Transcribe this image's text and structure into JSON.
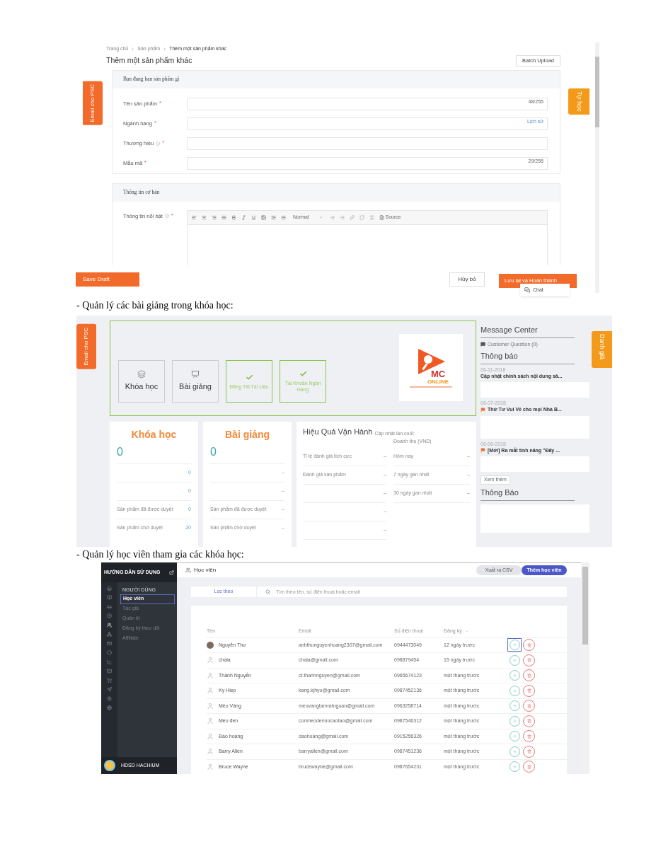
{
  "screen_1": {
    "left_tab": "Email cho PSC",
    "right_tab": "Tự học",
    "breadcrumb": [
      "Trang chủ",
      "Sản phẩm",
      "Thêm một sản phẩm khác"
    ],
    "title": "Thêm một sản phẩm khác",
    "batch_upload": "Batch Upload",
    "section_1": {
      "title": "Bạn đang bạn sản phẩm gì",
      "fields": [
        {
          "label": "Tên sản phẩm",
          "info": false,
          "mark": "*",
          "counter": "48/255"
        },
        {
          "label": "Ngành hàng",
          "info": false,
          "mark": "*",
          "link": "Lịch sử"
        },
        {
          "label": "Thương hiệu",
          "info": true,
          "mark": "*"
        },
        {
          "label": "Mẫu mã",
          "info": false,
          "mark": "*",
          "counter": "29/255"
        }
      ]
    },
    "section_2": {
      "title": "Thông tin cơ bản",
      "field": {
        "label": "Thông tin nổi bật",
        "info": true,
        "mark": "*"
      },
      "format": "Normal",
      "source": "Source"
    },
    "save_draft": "Save Draft",
    "cancel": "Hủy bỏ",
    "finish": "Lưu lại và Hoàn thành",
    "chat": "Chat"
  },
  "caption_1": "- Quản lý các bài giảng trong khóa học:",
  "screen_2": {
    "left_tab": "Email cho PSC",
    "right_tab": "Danh giá",
    "tiles": [
      {
        "label": "Khóa học",
        "kind": "courses"
      },
      {
        "label": "Bài giảng",
        "kind": "lectures"
      },
      {
        "label": "Đăng Tải Tài Liệu",
        "kind": "done"
      },
      {
        "label": "Tài Khoản Ngân Hàng",
        "kind": "done"
      }
    ],
    "logo": {
      "line_1": "MC",
      "line_2": "ONLINE"
    },
    "cards": [
      {
        "title": "Khóa học",
        "count": "0",
        "rows": [
          {
            "value": "0"
          },
          {
            "value": "0"
          },
          {
            "label": "Sản phẩm đã được duyệt",
            "value": "0"
          },
          {
            "label": "Sản phẩm chờ duyệt",
            "value": "20"
          }
        ]
      },
      {
        "title": "Bài giảng",
        "count": "0",
        "rows": [
          {
            "value": "–"
          },
          {
            "value": "–"
          },
          {
            "label": "Sản phẩm đã được duyệt",
            "value": "–"
          },
          {
            "label": "Sản phẩm chờ duyệt",
            "value": "–"
          }
        ]
      }
    ],
    "performance": {
      "title": "Hiệu Quả Vận Hành",
      "updated": "Cập nhật lần cuối:",
      "revenue_heading": "Doanh thu (VND)",
      "left_rows": [
        {
          "label": "Tỉ lệ đánh giá tích cực",
          "value": "–"
        },
        {
          "label": "Đánh giá sản phẩm",
          "value": "–"
        },
        {
          "value": "–"
        },
        {
          "value": "–"
        },
        {
          "value": "–"
        }
      ],
      "right_rows": [
        {
          "label": "Hôm nay",
          "value": "–"
        },
        {
          "label": "7 ngày gần nhất",
          "value": "–"
        },
        {
          "label": "30 ngày gần nhất",
          "value": "–"
        }
      ]
    },
    "messages": {
      "title": "Message Center",
      "customer_question": "Customer Question (0)",
      "notices_title": "Thông báo",
      "notices": [
        {
          "date": "06-11-2018",
          "title": "Cập nhật chính sách nội dung sả...",
          "flag": false
        },
        {
          "date": "06-07-2018",
          "title": "Thứ Tư Vui Vẻ cho mọi Nhà B...",
          "flag": true
        },
        {
          "date": "06-06-2018",
          "title": "[Mới] Ra mắt tính năng \"Đẩy ...",
          "flag": true
        }
      ],
      "more": "Xem thêm",
      "second_title": "Thông Báo"
    }
  },
  "caption_2": "- Quản lý học viên tham gia các khóa học:",
  "screen_3": {
    "sidebar_title": "HƯỚNG DẪN SỬ DỤNG",
    "rail_icons": [
      {
        "selected": false
      },
      {
        "selected": false
      },
      {
        "selected": false
      },
      {
        "selected": false
      },
      {
        "selected": true
      },
      {
        "selected": false
      },
      {
        "selected": false
      },
      {
        "selected": false
      },
      {
        "selected": false
      },
      {
        "selected": false
      },
      {
        "selected": false
      },
      {
        "selected": false
      },
      {
        "selected": false
      },
      {
        "selected": false
      }
    ],
    "menu_heading": "NGƯỜI DÙNG",
    "menu": [
      {
        "label": "Học viên",
        "selected": true
      },
      {
        "label": "Tác giả",
        "selected": false
      },
      {
        "label": "Quản trị",
        "selected": false
      },
      {
        "label": "Đăng ký theo dõi",
        "selected": false
      },
      {
        "label": "Affiliate",
        "selected": false
      }
    ],
    "user": "HDSD HACHIUM",
    "page_title": "Học viên",
    "export": "Xuất ra CSV",
    "add": "Thêm học viên",
    "filter": "Lọc theo",
    "search": {
      "placeholder": "Tìm theo tên, số điện thoại hoặc email"
    },
    "columns": [
      "Tên",
      "Email",
      "Số điện thoại",
      "Đăng ký"
    ],
    "rows": [
      {
        "name": "Nguyễn Thư",
        "photo": true,
        "email": "anhthunguyenhoang2307@gmail.com",
        "phone": "0944473049",
        "joined": "12 ngày trước",
        "focused": true
      },
      {
        "name": "chala",
        "photo": false,
        "email": "chala@gmail.com",
        "phone": "098879454",
        "joined": "15 ngày trước",
        "focused": false
      },
      {
        "name": "Thành Nguyễn",
        "photo": false,
        "email": "ct.thanhnguyen@gmail.com",
        "phone": "0965674123",
        "joined": "một tháng trước",
        "focused": false
      },
      {
        "name": "Ky Hiep",
        "photo": false,
        "email": "kang.kjhyo@gmail.com",
        "phone": "0987452136",
        "joined": "một tháng trước",
        "focused": false
      },
      {
        "name": "Mèo Vàng",
        "photo": false,
        "email": "meovangtamratngoan@gmail.com",
        "phone": "0963258714",
        "joined": "một tháng trước",
        "focused": false
      },
      {
        "name": "Mèo đen",
        "photo": false,
        "email": "conmeodennocaotao@gmail.com",
        "phone": "0987546312",
        "joined": "một tháng trước",
        "focused": false
      },
      {
        "name": "Đào hoàng",
        "photo": false,
        "email": "daohoang@gmail.com",
        "phone": "0915256326",
        "joined": "một tháng trước",
        "focused": false
      },
      {
        "name": "Barry Allen",
        "photo": false,
        "email": "barryallen@gmail.com",
        "phone": "0987451236",
        "joined": "một tháng trước",
        "focused": false
      },
      {
        "name": "Bruce Wayne",
        "photo": false,
        "email": "brucewayne@gmail.com",
        "phone": "0987654231",
        "joined": "một tháng trước",
        "focused": false
      }
    ]
  }
}
